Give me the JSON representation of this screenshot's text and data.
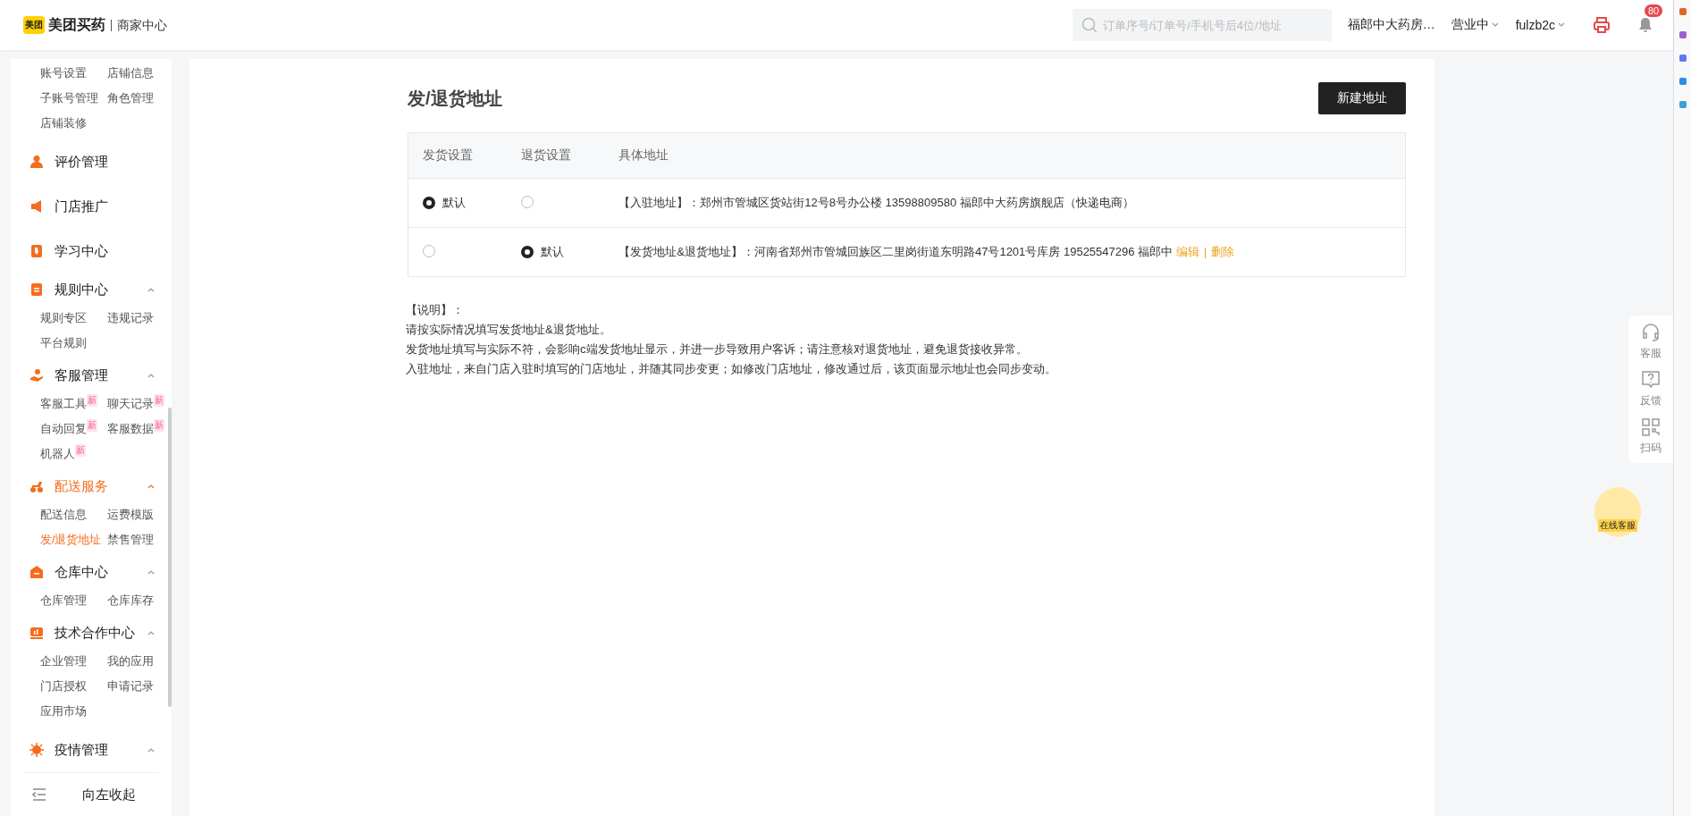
{
  "header": {
    "logo_mark": "美团",
    "brand": "美团买药",
    "section": "商家中心",
    "search": {
      "placeholder": "订单序号/订单号/手机号后4位/地址"
    },
    "store": "福郎中大药房…",
    "status": "营业中",
    "user": "fulzb2c",
    "notification_count": "80"
  },
  "sidebar": {
    "groups": [
      {
        "items": [
          {
            "label": "账号设置",
            "selected": false
          },
          {
            "label": "店铺信息",
            "selected": false
          },
          {
            "label": "子账号管理",
            "selected": false
          },
          {
            "label": "角色管理",
            "selected": false
          },
          {
            "label": "店铺装修",
            "selected": false
          }
        ]
      },
      {
        "label": "评价管理",
        "active": false
      },
      {
        "label": "门店推广",
        "active": false
      },
      {
        "label": "学习中心",
        "active": false
      },
      {
        "label": "规则中心",
        "expanded": true,
        "active": false,
        "items": [
          {
            "label": "规则专区",
            "selected": false
          },
          {
            "label": "违规记录",
            "selected": false
          },
          {
            "label": "平台规则",
            "selected": false
          }
        ]
      },
      {
        "label": "客服管理",
        "expanded": true,
        "active": false,
        "items": [
          {
            "label": "客服工具",
            "selected": false,
            "badge": "新"
          },
          {
            "label": "聊天记录",
            "selected": false,
            "badge": "新"
          },
          {
            "label": "自动回复",
            "selected": false,
            "badge": "新"
          },
          {
            "label": "客服数据",
            "selected": false,
            "badge": "新"
          },
          {
            "label": "机器人",
            "selected": false,
            "badge": "新"
          }
        ]
      },
      {
        "label": "配送服务",
        "expanded": true,
        "active": true,
        "items": [
          {
            "label": "配送信息",
            "selected": false
          },
          {
            "label": "运费模版",
            "selected": false
          },
          {
            "label": "发/退货地址",
            "selected": true
          },
          {
            "label": "禁售管理",
            "selected": false
          }
        ]
      },
      {
        "label": "仓库中心",
        "expanded": true,
        "active": false,
        "items": [
          {
            "label": "仓库管理",
            "selected": false
          },
          {
            "label": "仓库库存",
            "selected": false
          }
        ]
      },
      {
        "label": "技术合作中心",
        "expanded": true,
        "active": false,
        "items": [
          {
            "label": "企业管理",
            "selected": false
          },
          {
            "label": "我的应用",
            "selected": false
          },
          {
            "label": "门店授权",
            "selected": false
          },
          {
            "label": "申请记录",
            "selected": false
          },
          {
            "label": "应用市场",
            "selected": false
          }
        ]
      },
      {
        "label": "疫情管理",
        "expanded": true,
        "active": false
      }
    ],
    "collapse": "向左收起"
  },
  "page": {
    "title": "发/退货地址",
    "new_button": "新建地址",
    "table": {
      "columns": [
        "发货设置",
        "退货设置",
        "具体地址"
      ],
      "rows": [
        {
          "ship": {
            "selected": true,
            "label": "默认"
          },
          "return": {
            "selected": false
          },
          "tag": "【入驻地址】：",
          "address": "郑州市管城区货站街12号8号办公楼 13598809580 福郎中大药房旗舰店（快递电商）"
        },
        {
          "ship": {
            "selected": false
          },
          "return": {
            "selected": true,
            "label": "默认"
          },
          "tag": "【发货地址&退货地址】：",
          "address": "河南省郑州市管城回族区二里岗街道东明路47号1201号库房 19525547296 福郎中",
          "actions": [
            "编辑",
            "删除"
          ]
        }
      ]
    },
    "notes": [
      "【说明】：",
      "请按实际情况填写发货地址&退货地址。",
      "发货地址填写与实际不符，会影响c端发货地址显示，并进一步导致用户客诉；请注意核对退货地址，避免退货接收异常。",
      "入驻地址，来自门店入驻时填写的门店地址，并随其同步变更；如修改门店地址，修改通过后，该页面显示地址也会同步变动。"
    ]
  },
  "float_tools": [
    {
      "label": "客服"
    },
    {
      "label": "反馈"
    },
    {
      "label": "扫码"
    }
  ],
  "online_service": "在线客服"
}
